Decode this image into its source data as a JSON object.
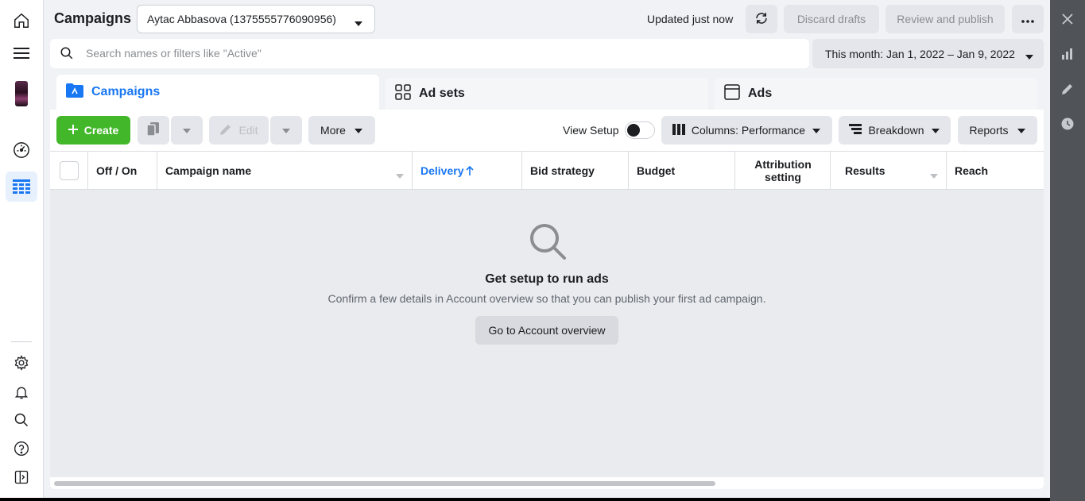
{
  "header": {
    "title": "Campaigns",
    "account": "Aytac Abbasova (1375555776090956)",
    "updated": "Updated just now",
    "discard": "Discard drafts",
    "review": "Review and publish"
  },
  "search": {
    "placeholder": "Search names or filters like \"Active\"",
    "value": ""
  },
  "date_range": "This month: Jan 1, 2022 – Jan 9, 2022",
  "tabs": [
    {
      "label": "Campaigns",
      "active": true
    },
    {
      "label": "Ad sets",
      "active": false
    },
    {
      "label": "Ads",
      "active": false
    }
  ],
  "toolbar": {
    "create": "Create",
    "edit": "Edit",
    "more": "More",
    "view_setup": "View Setup",
    "columns": "Columns: Performance",
    "breakdown": "Breakdown",
    "reports": "Reports"
  },
  "table": {
    "columns": [
      "Off / On",
      "Campaign name",
      "Delivery",
      "Bid strategy",
      "Budget",
      "Attribution setting",
      "Results",
      "Reach"
    ],
    "sorted_column": "Delivery",
    "sort_direction": "ascending"
  },
  "empty_state": {
    "title": "Get setup to run ads",
    "description": "Confirm a few details in Account overview so that you can publish your first ad campaign.",
    "button": "Go to Account overview"
  },
  "colors": {
    "accent": "#1877f2",
    "create_green": "#42b72a",
    "right_rail": "#505459"
  },
  "icons": [
    "home-icon",
    "menu-icon",
    "dashboard-icon",
    "table-icon",
    "gear-icon",
    "bell-icon",
    "search-icon",
    "help-icon",
    "panel-icon",
    "close-icon",
    "chart-icon",
    "pencil-icon",
    "clock-icon"
  ]
}
